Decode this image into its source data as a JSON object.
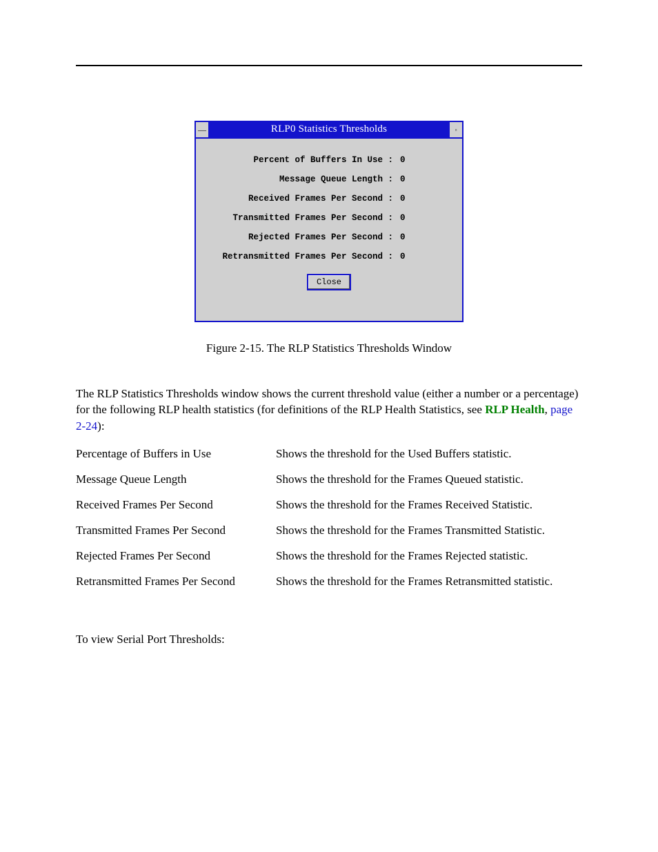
{
  "dialog": {
    "title": "RLP0 Statistics Thresholds",
    "menu_glyph": "—",
    "resize_glyph": "▫",
    "rows": [
      {
        "label": "Percent of Buffers In Use :",
        "value": "0"
      },
      {
        "label": "Message Queue Length :",
        "value": "0"
      },
      {
        "label": "Received Frames Per Second :",
        "value": "0"
      },
      {
        "label": "Transmitted Frames Per Second :",
        "value": "0"
      },
      {
        "label": "Rejected Frames Per Second :",
        "value": "0"
      },
      {
        "label": "Retransmitted Frames Per Second :",
        "value": "0"
      }
    ],
    "close_label": "Close"
  },
  "caption": "Figure 2-15.  The RLP Statistics Thresholds Window",
  "para": {
    "pre": "The RLP Statistics Thresholds window shows the current threshold value (either a number or a percentage) for the following RLP health statistics (for definitions of the RLP Health Statistics, see ",
    "link": "RLP Health",
    "mid": ", ",
    "pageref": "page 2-24",
    "post": "):"
  },
  "defs": [
    {
      "term": "Percentage of Buffers in Use",
      "desc": "Shows the threshold for the Used Buffers statistic."
    },
    {
      "term": "Message Queue Length",
      "desc": "Shows the threshold for the Frames Queued statistic."
    },
    {
      "term": "Received Frames Per Second",
      "desc": "Shows the threshold for the Frames Received Statistic."
    },
    {
      "term": "Transmitted Frames Per Second",
      "desc": "Shows the threshold for the Frames Transmitted Statistic."
    },
    {
      "term": "Rejected Frames Per Second",
      "desc": "Shows the threshold for the Frames Rejected statistic."
    },
    {
      "term": "Retransmitted Frames Per Second",
      "desc": "Shows the threshold for the Frames Retransmitted statistic."
    }
  ],
  "tail": "To view Serial Port Thresholds:"
}
